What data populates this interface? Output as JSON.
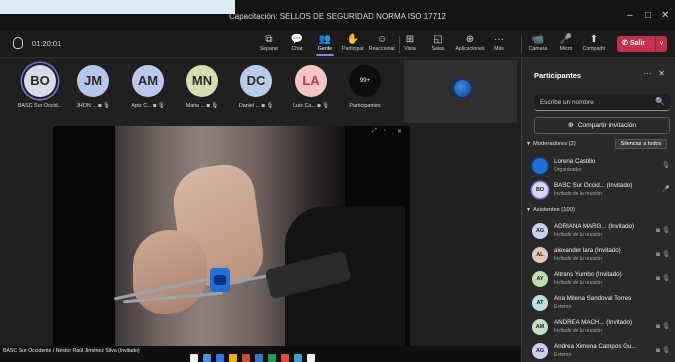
{
  "window": {
    "title": "Capacitación: SELLOS DE SEGURIDAD NORMA ISO 17712",
    "controls": {
      "minimize": "–",
      "maximize": "□",
      "close": "✕"
    }
  },
  "toolbar": {
    "timer": "01:20:01",
    "buttons": [
      {
        "label": "Separar",
        "icon": "⧉"
      },
      {
        "label": "Chat",
        "icon": "💬"
      },
      {
        "label": "Gente",
        "icon": "👥",
        "active": true
      },
      {
        "label": "Participar",
        "icon": "✋"
      },
      {
        "label": "Reaccionar",
        "icon": "☺"
      },
      {
        "label": "Vista",
        "icon": "⊞"
      },
      {
        "label": "Salas",
        "icon": "◱"
      },
      {
        "label": "Aplicaciones",
        "icon": "⊕"
      },
      {
        "label": "Más",
        "icon": "···"
      }
    ],
    "devices": [
      {
        "label": "Cámara",
        "icon": "📹"
      },
      {
        "label": "Micro",
        "icon": "🎤"
      },
      {
        "label": "Compartir",
        "icon": "⬆"
      }
    ],
    "leave_label": "Salir",
    "leave_icon": "✆",
    "leave_dropdown": "∨"
  },
  "gallery": [
    {
      "initials": "BO",
      "name": "BASC Sur Occid...",
      "color": "#d7dbe8",
      "speaking": true
    },
    {
      "initials": "JM",
      "name": "JHON ... ◙ 🎙",
      "color": "#b7c5ea"
    },
    {
      "initials": "AM",
      "name": "Apix C... ◙ 🎙",
      "color": "#b9c8ec"
    },
    {
      "initials": "MN",
      "name": "Maria ... ◙ 🎙",
      "color": "#d6ddb0"
    },
    {
      "initials": "DC",
      "name": "Daniel ... ◙ 🎙",
      "color": "#b7ccec"
    },
    {
      "initials": "LA",
      "name": "Luis Ca... ◙ 🎙",
      "color": "#f1c7c0"
    }
  ],
  "gallery_more": {
    "count": "99+",
    "label": "Participantes"
  },
  "video": {
    "speaker_tag": "BASC Sur Occidente / Néstor Raúl Jiménez Silva (Invitado)",
    "controls": [
      "⤢",
      "▫",
      "✕"
    ]
  },
  "panel": {
    "title": "Participantes",
    "icons": {
      "more": "···",
      "close": "✕"
    },
    "search_placeholder": "Escribe un nombre",
    "search_icon": "🔍",
    "invite_label": "Compartir invitación",
    "invite_icon": "⊕",
    "moderators_header": "Moderadores (2)",
    "mute_all": "Silenciar a todos",
    "attendees_header": "Asistentes (100)",
    "moderators": [
      {
        "initials": "",
        "name": "Lorena Castillo",
        "role": "Organizador",
        "color": "#1f6fd6",
        "action": "🎙"
      },
      {
        "initials": "BO",
        "name": "BASC Sur Occid... (Invitado)",
        "role": "Invitado de la reunión",
        "color": "#d7dbe8",
        "action": "🎤"
      }
    ],
    "attendees": [
      {
        "initials": "AG",
        "name": "ADRIANA MARG... (Invitado)",
        "role": "Invitado de la reunión",
        "color": "#c9d2ee",
        "action": "◙ 🎙"
      },
      {
        "initials": "AL",
        "name": "alexander lara (Invitado)",
        "role": "Invitado de la reunión",
        "color": "#e3c8b5",
        "action": "◙ 🎙"
      },
      {
        "initials": "AY",
        "name": "Altrans Yumbo (Invitado)",
        "role": "Invitado de la reunión",
        "color": "#bfe0b1",
        "action": "◙ 🎙"
      },
      {
        "initials": "AT",
        "name": "Ana Milena Sandoval Torres",
        "role": "Externo",
        "color": "#b9e0e7",
        "action": ""
      },
      {
        "initials": "AM",
        "name": "ANDREA MACH... (Invitado)",
        "role": "Invitado de la reunión",
        "color": "#c2e3c2",
        "action": "◙ 🎙"
      },
      {
        "initials": "AG",
        "name": "Andrea Ximena Campos Gu...",
        "role": "Externo",
        "color": "#c9d2ee",
        "action": "◙ 🎙"
      }
    ]
  },
  "taskbar": {
    "icons": [
      "#f2f2f2",
      "#4a8fe0",
      "#2d7be0",
      "#f0b400",
      "#d64b2a",
      "#2b79d0",
      "#1f9d55",
      "#e04a3a",
      "#3aa0d8",
      "#f0f0f0"
    ]
  }
}
